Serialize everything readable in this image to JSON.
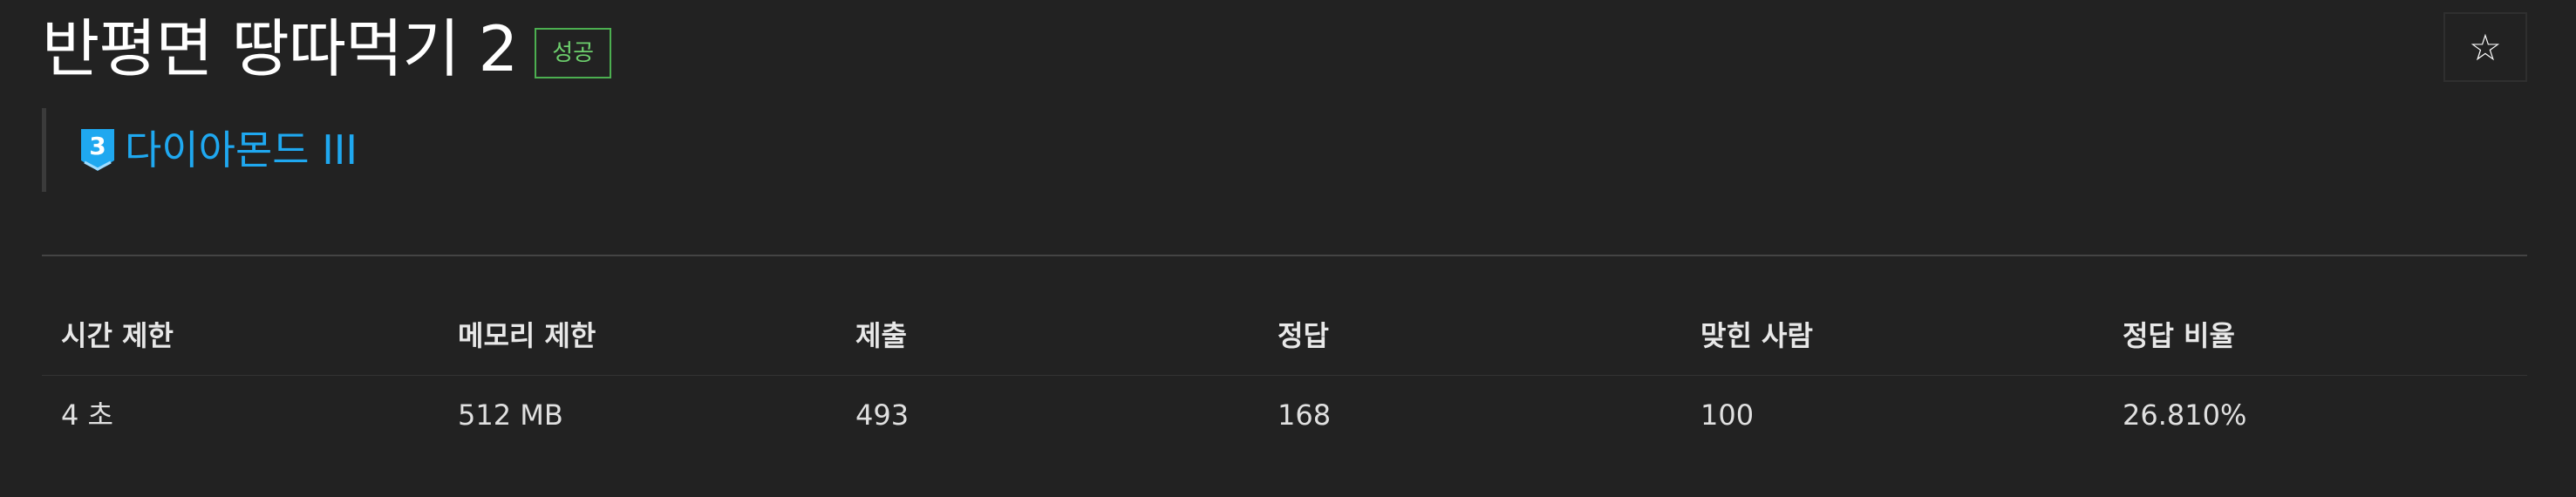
{
  "problem": {
    "title": "반평면 땅따먹기 2",
    "status_badge": "성공"
  },
  "tier": {
    "level_number": "3",
    "label": "다이아몬드 III",
    "color": "#1fa8f0"
  },
  "favorite": {
    "icon": "star-outline-icon",
    "glyph": "☆"
  },
  "stats": {
    "headers": [
      "시간 제한",
      "메모리 제한",
      "제출",
      "정답",
      "맞힌 사람",
      "정답 비율"
    ],
    "values": [
      "4 초",
      "512 MB",
      "493",
      "168",
      "100",
      "26.810%"
    ]
  }
}
